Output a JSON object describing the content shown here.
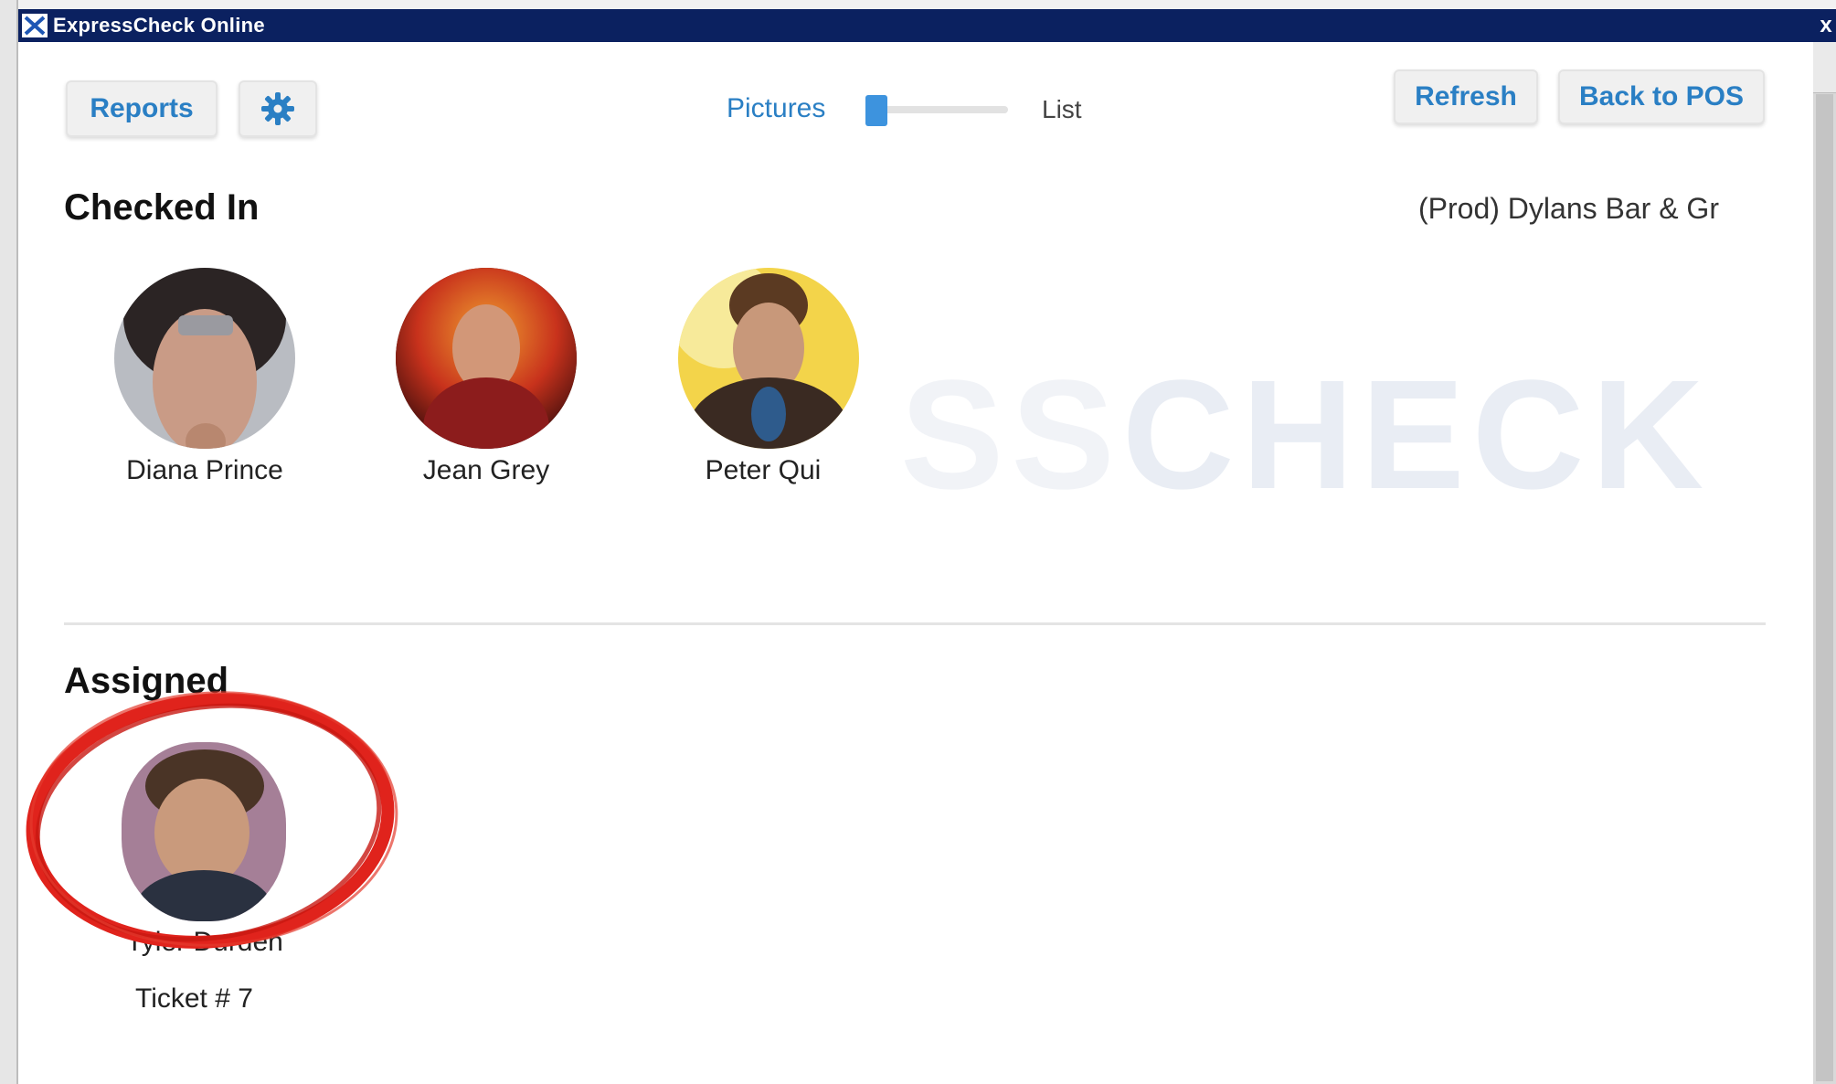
{
  "window": {
    "title": "ExpressCheck Online",
    "close_glyph": "x"
  },
  "toolbar": {
    "reports_label": "Reports",
    "settings_icon": "gear-icon",
    "pictures_label": "Pictures",
    "view_mode_label": "List",
    "refresh_label": "Refresh",
    "back_label": "Back to POS",
    "accent_color": "#2a7fc4"
  },
  "checked_in": {
    "heading": "Checked In",
    "location": "(Prod) Dylans Bar & Gr",
    "people": [
      {
        "name": "Diana Prince"
      },
      {
        "name": "Jean Grey"
      },
      {
        "name": "Peter Qui"
      }
    ]
  },
  "watermark": {
    "text_a": "SS",
    "text_b": "CHECK"
  },
  "assigned": {
    "heading": "Assigned",
    "people": [
      {
        "name": "Tyler Durden",
        "ticket": "Ticket # 7"
      }
    ]
  }
}
